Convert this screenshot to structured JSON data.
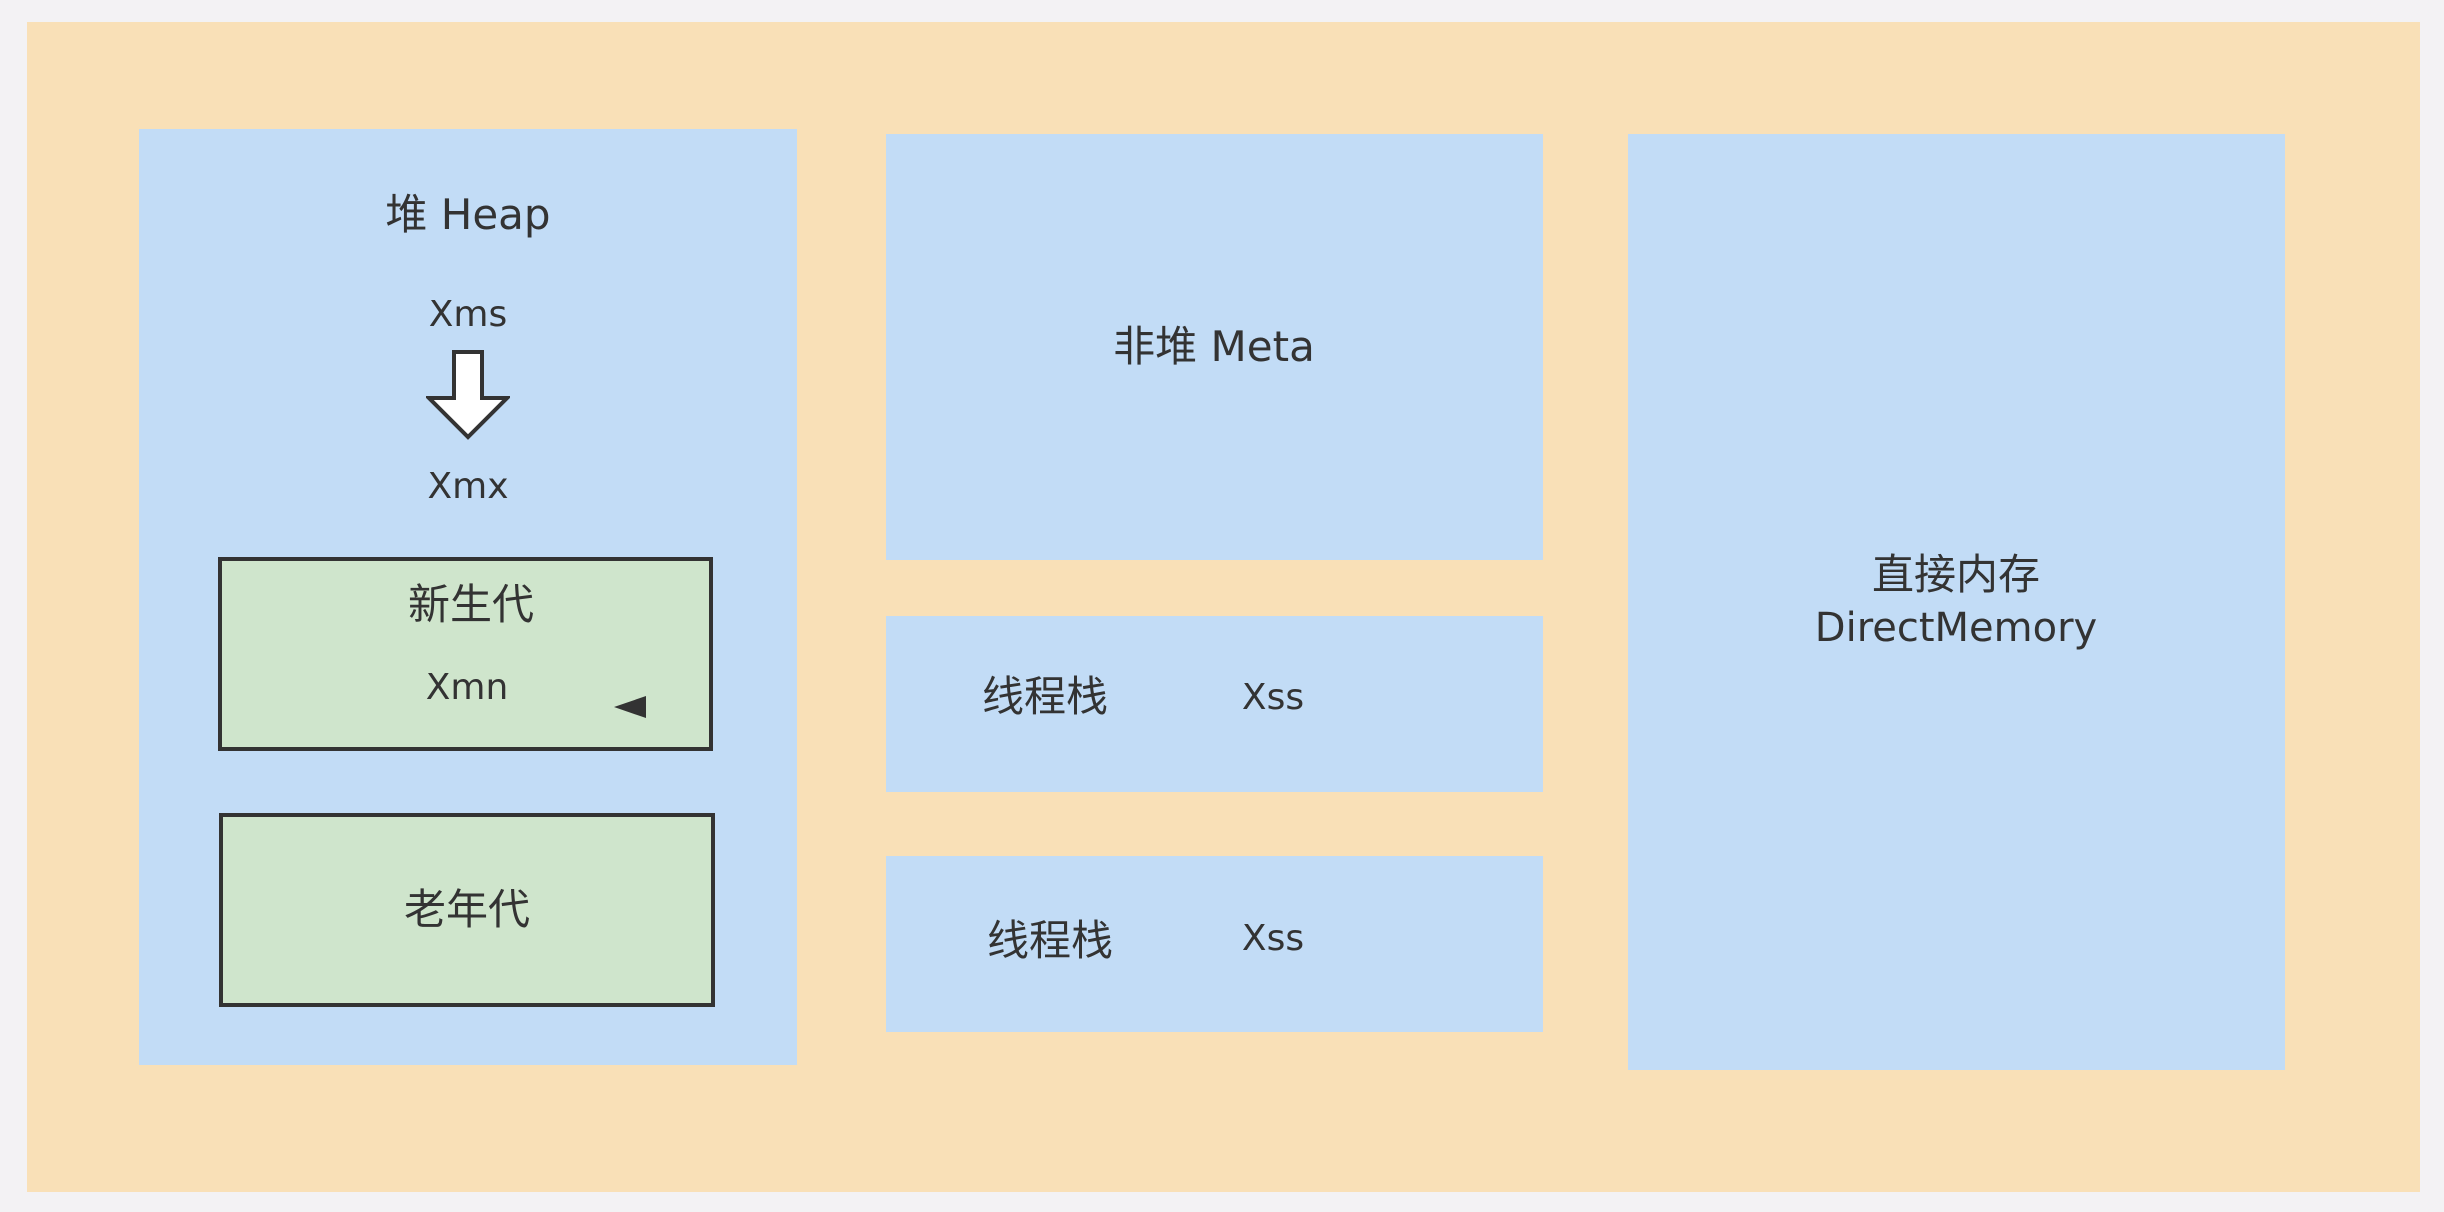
{
  "heap": {
    "title": "堆 Heap",
    "xms": "Xms",
    "xmx": "Xmx",
    "young_gen": {
      "title": "新生代",
      "param": "Xmn"
    },
    "old_gen": {
      "title": "老年代"
    }
  },
  "meta": {
    "title": "非堆 Meta"
  },
  "thread_stacks": [
    {
      "title": "线程栈",
      "param": "Xss"
    },
    {
      "title": "线程栈",
      "param": "Xss"
    }
  ],
  "direct_memory": {
    "line1": "直接内存",
    "line2": "DirectMemory"
  },
  "colors": {
    "outer_background": "#f9e0b7",
    "region_blue": "#c2dcf6",
    "generation_green": "#cfe5cc",
    "stroke": "#333333"
  },
  "icons": {
    "heap_arrow": "arrow-down-icon",
    "young_gen_marker": "triangle-left-icon"
  }
}
